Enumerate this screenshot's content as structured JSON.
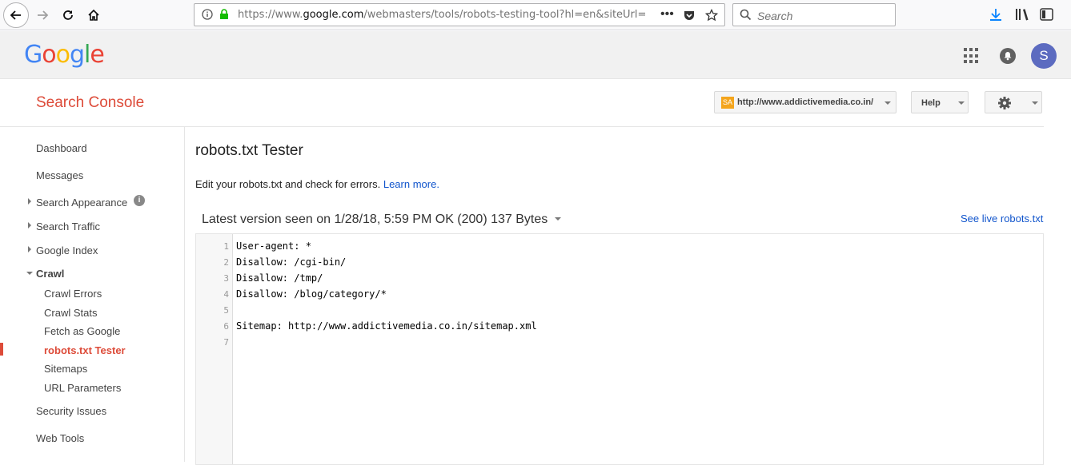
{
  "browser": {
    "url_prefix": "https://www.",
    "url_domain": "google.com",
    "url_rest": "/webmasters/tools/robots-testing-tool?hl=en&siteUrl=",
    "search_placeholder": "Search"
  },
  "header": {
    "logo": [
      "G",
      "o",
      "o",
      "g",
      "l",
      "e"
    ],
    "avatar_letter": "S"
  },
  "console": {
    "title": "Search Console",
    "site": "http://www.addictivemedia.co.in/",
    "site_fav": "SA",
    "help_label": "Help"
  },
  "sidebar": {
    "items": [
      {
        "label": "Dashboard"
      },
      {
        "label": "Messages"
      },
      {
        "label": "Search Appearance"
      },
      {
        "label": "Search Traffic"
      },
      {
        "label": "Google Index"
      },
      {
        "label": "Crawl"
      },
      {
        "label": "Security Issues"
      },
      {
        "label": "Web Tools"
      }
    ],
    "crawl_sub": [
      {
        "label": "Crawl Errors"
      },
      {
        "label": "Crawl Stats"
      },
      {
        "label": "Fetch as Google"
      },
      {
        "label": "robots.txt Tester"
      },
      {
        "label": "Sitemaps"
      },
      {
        "label": "URL Parameters"
      }
    ]
  },
  "main": {
    "title": "robots.txt Tester",
    "description": "Edit your robots.txt and check for errors.",
    "learn_more": "Learn more.",
    "version": "Latest version seen on 1/28/18, 5:59 PM OK (200) 137 Bytes",
    "see_live": "See live robots.txt",
    "lines": [
      {
        "num": "1",
        "text": "User-agent: *"
      },
      {
        "num": "2",
        "text": "Disallow: /cgi-bin/"
      },
      {
        "num": "3",
        "text": "Disallow: /tmp/"
      },
      {
        "num": "4",
        "text": "Disallow: /blog/category/*"
      },
      {
        "num": "5",
        "text": ""
      },
      {
        "num": "6",
        "text": "Sitemap: http://www.addictivemedia.co.in/sitemap.xml"
      },
      {
        "num": "7",
        "text": ""
      }
    ]
  }
}
